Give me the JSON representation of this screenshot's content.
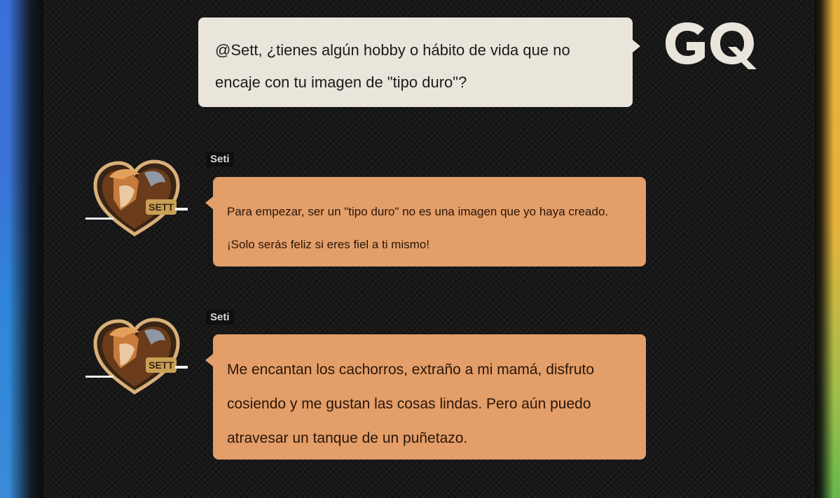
{
  "brand": {
    "logo_text": "GQ",
    "logo_color": "#e9e5db"
  },
  "colors": {
    "question_bubble": "#e9e5db",
    "answer_bubble": "#e39e69",
    "background": "#161616",
    "left_edge": "#3b6fd8",
    "right_edge": "#e6b23c"
  },
  "conversation": {
    "question": {
      "line1": "@Sett, ¿tienes algún hobby o hábito de vida que no",
      "line2": "encaje con tu imagen de \"tipo duro\"?"
    },
    "replies": [
      {
        "author": "Seti",
        "avatar_label": "SETT",
        "lines": [
          "Para empezar, ser un \"tipo duro\" no es una imagen que yo haya creado.",
          "¡Solo serás feliz si eres fiel a ti mismo!"
        ]
      },
      {
        "author": "Seti",
        "avatar_label": "SETT",
        "lines": [
          "Me encantan los cachorros, extraño a mi mamá, disfruto",
          "cosiendo y me gustan las cosas lindas. Pero aún puedo",
          "atravesar un tanque de un puñetazo."
        ]
      }
    ]
  }
}
